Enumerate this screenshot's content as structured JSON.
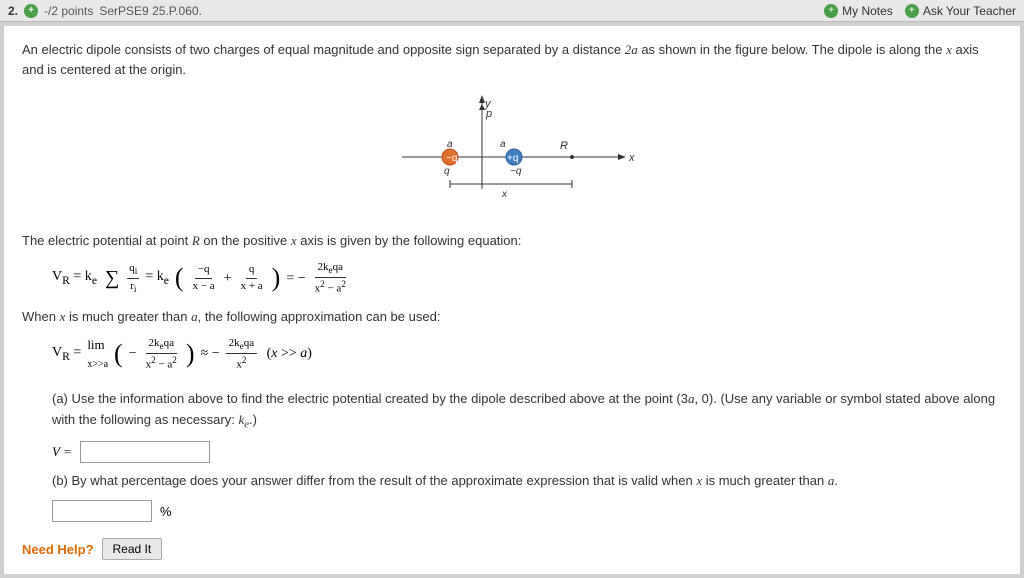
{
  "topbar": {
    "question_num": "2.",
    "points_label": "-/2 points",
    "series_id": "SerPSE9 25.P.060.",
    "my_notes_label": "My Notes",
    "ask_teacher_label": "Ask Your Teacher"
  },
  "problem": {
    "intro": "An electric dipole consists of two charges of equal magnitude and opposite sign separated by a distance 2a as shown in the figure below. The dipole is along the x axis and is centered at the origin.",
    "eq_label": "The electric potential at point R on the positive x axis is given by the following equation:",
    "approx_label": "When x is much greater than a, the following approximation can be used:",
    "part_a": {
      "label": "(a)",
      "text": "Use the information above to find the electric potential created by the dipole described above at the point (3a, 0). (Use any variable or symbol stated above along with the following as necessary: k",
      "subscript": "e",
      "text2": ".)",
      "v_label": "V ="
    },
    "part_b": {
      "label": "(b)",
      "text": "By what percentage does your answer differ from the result of the approximate expression that is valid when x is much greater than a.",
      "percent_label": "%"
    },
    "need_help": "Need Help?",
    "read_it": "Read It"
  }
}
